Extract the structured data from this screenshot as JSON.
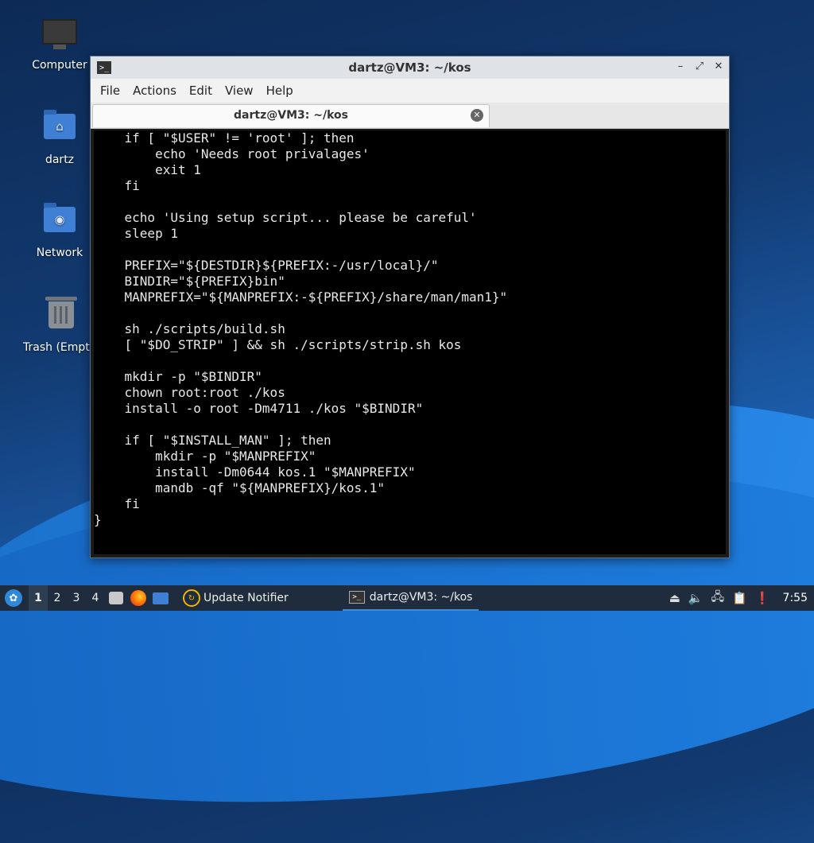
{
  "desktop": {
    "icons": [
      {
        "label": "Computer",
        "icon": "computer-icon"
      },
      {
        "label": "dartz",
        "icon": "home-folder-icon"
      },
      {
        "label": "Network",
        "icon": "network-folder-icon"
      },
      {
        "label": "Trash (Empty)",
        "icon": "trash-icon"
      }
    ]
  },
  "window": {
    "title": "dartz@VM3: ~/kos",
    "menu": [
      "File",
      "Actions",
      "Edit",
      "View",
      "Help"
    ],
    "tab_label": "dartz@VM3: ~/kos",
    "controls": {
      "minimize": "–",
      "maximize": "⤢",
      "close": "✕"
    }
  },
  "terminal": {
    "lines": [
      "    if [ \"$USER\" != 'root' ]; then",
      "        echo 'Needs root privalages'",
      "        exit 1",
      "    fi",
      "",
      "    echo 'Using setup script... please be careful'",
      "    sleep 1",
      "",
      "    PREFIX=\"${DESTDIR}${PREFIX:-/usr/local}/\"",
      "    BINDIR=\"${PREFIX}bin\"",
      "    MANPREFIX=\"${MANPREFIX:-${PREFIX}/share/man/man1}\"",
      "",
      "    sh ./scripts/build.sh",
      "    [ \"$DO_STRIP\" ] && sh ./scripts/strip.sh kos",
      "",
      "    mkdir -p \"$BINDIR\"",
      "    chown root:root ./kos",
      "    install -o root -Dm4711 ./kos \"$BINDIR\"",
      "",
      "    if [ \"$INSTALL_MAN\" ]; then",
      "        mkdir -p \"$MANPREFIX\"",
      "        install -Dm0644 kos.1 \"$MANPREFIX\"",
      "        mandb -qf \"${MANPREFIX}/kos.1\"",
      "    fi",
      "}"
    ]
  },
  "taskbar": {
    "workspaces": [
      "1",
      "2",
      "3",
      "4"
    ],
    "update_notifier": "Update Notifier",
    "terminal_task": "dartz@VM3: ~/kos",
    "clock": "7:55"
  }
}
